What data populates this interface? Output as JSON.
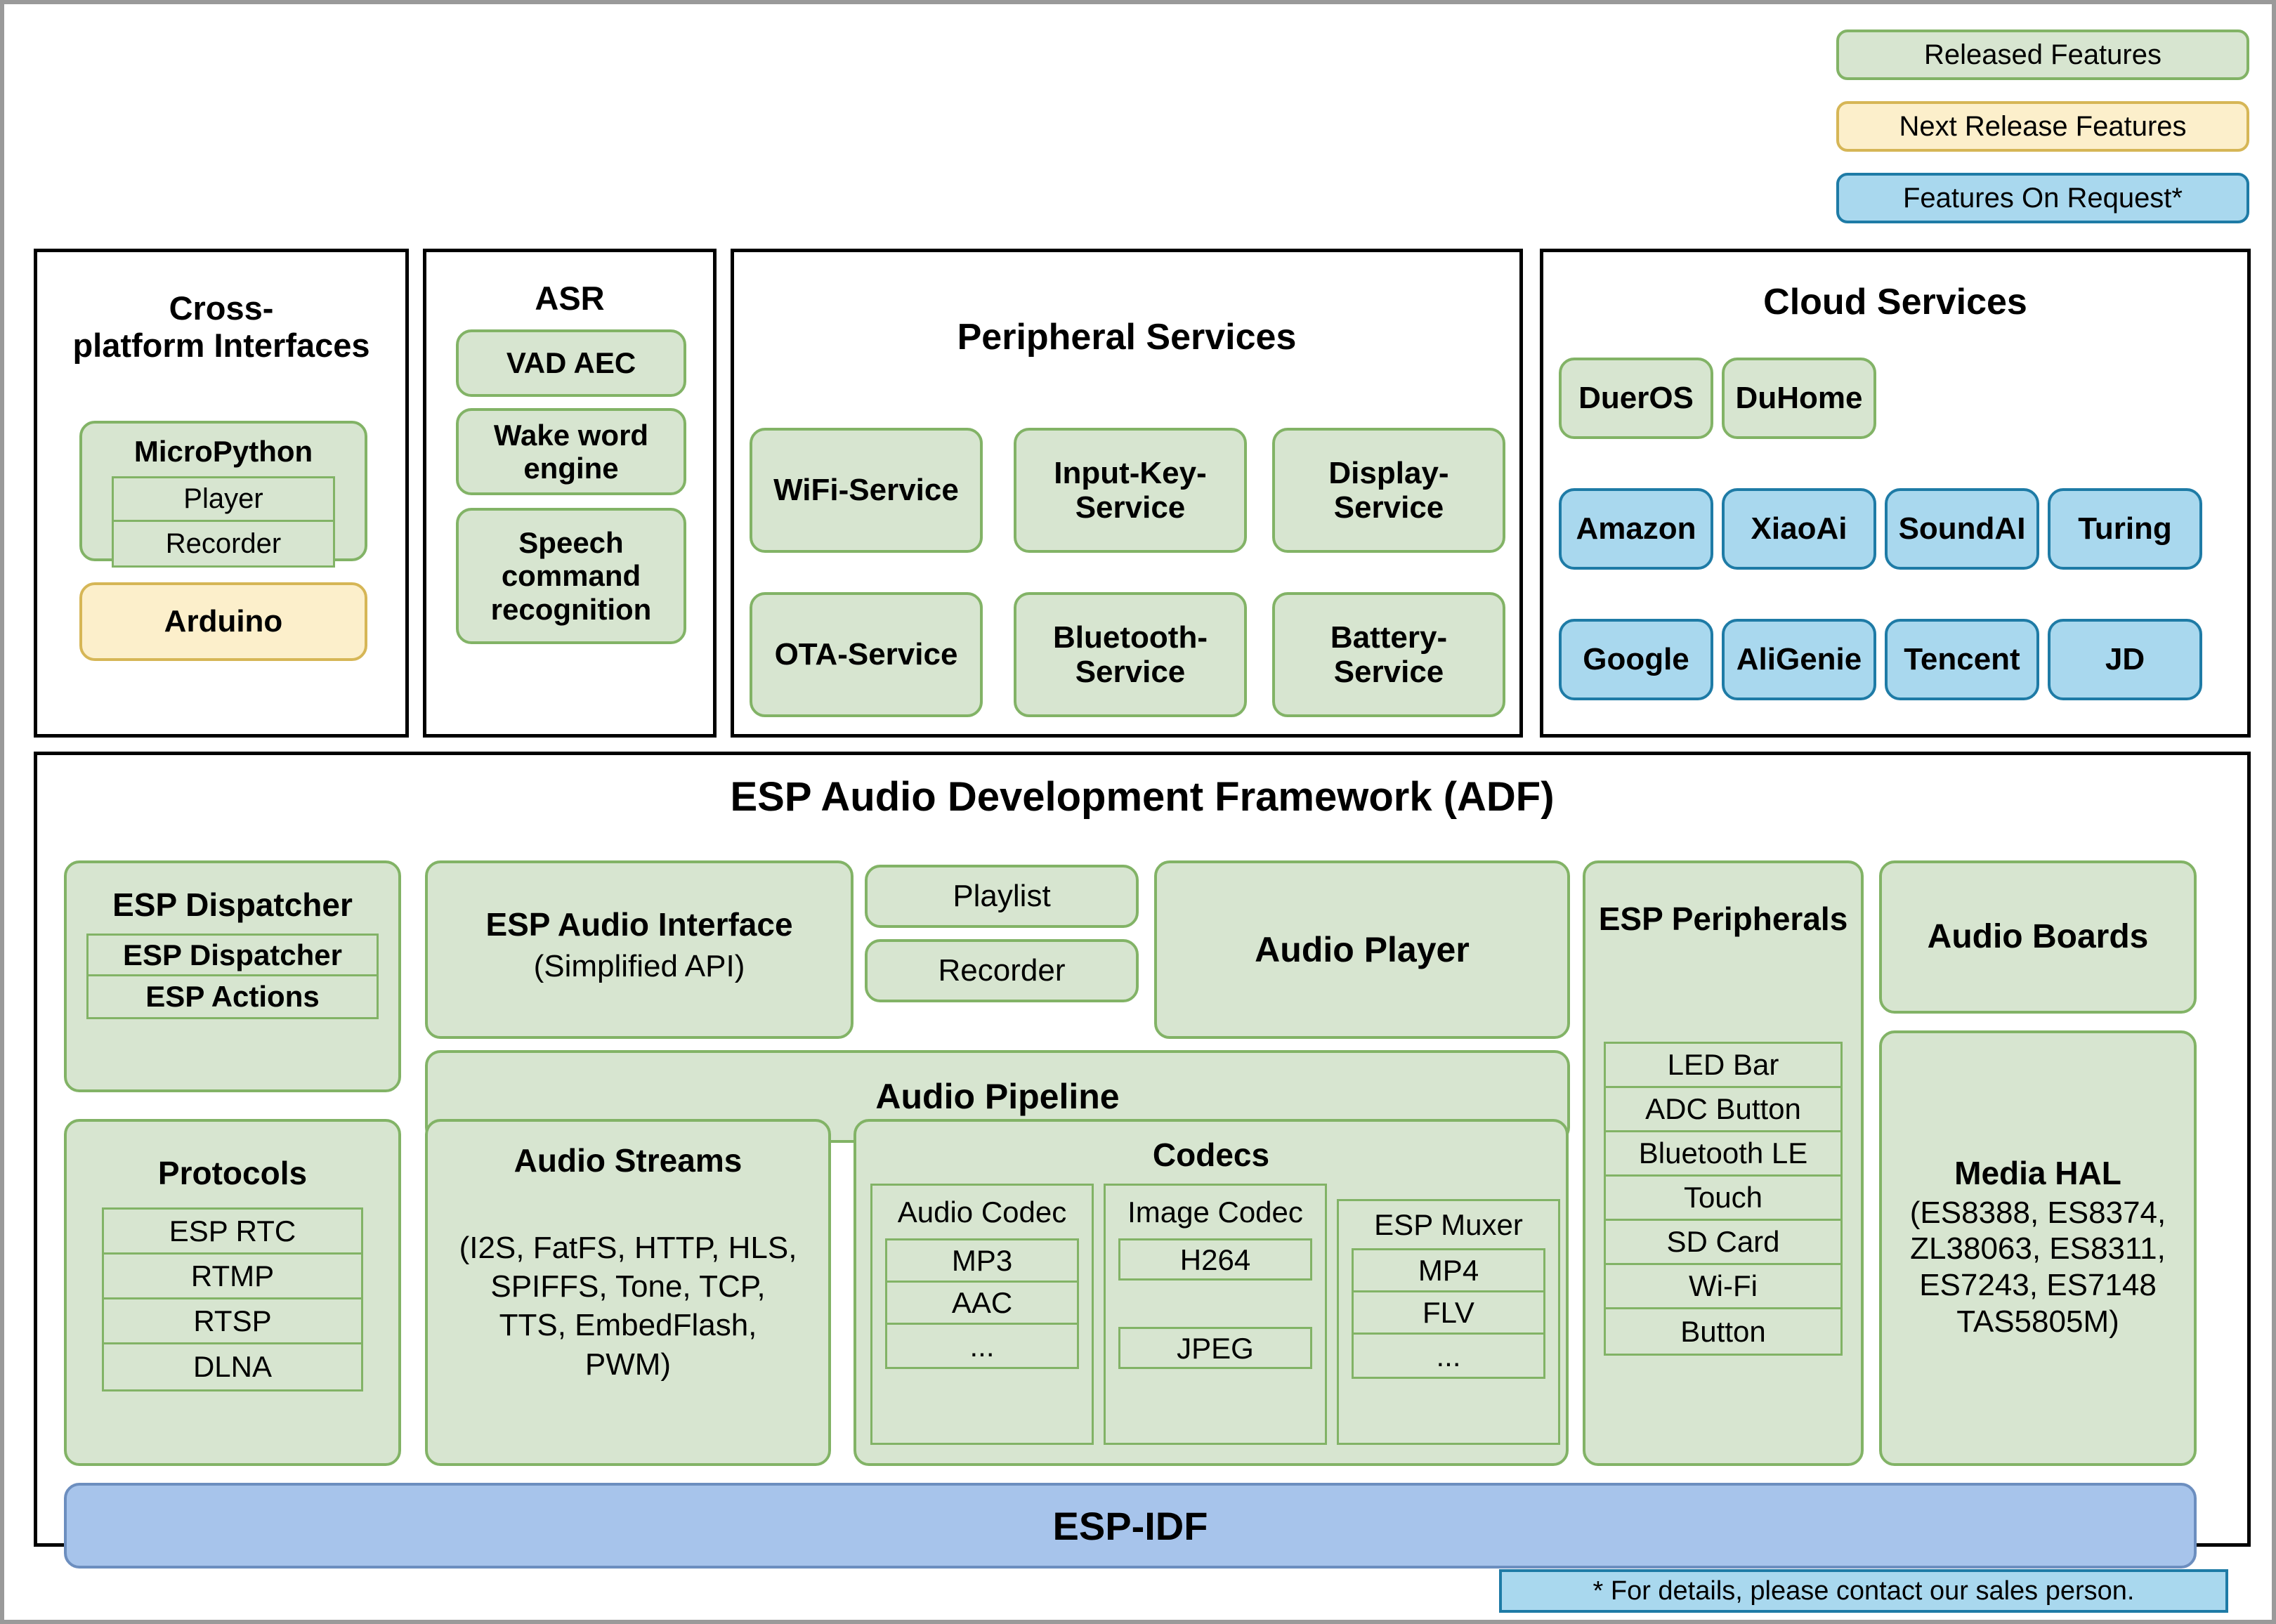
{
  "legend": {
    "items": [
      {
        "label": "Released Features",
        "color": "#d7e5d0"
      },
      {
        "label": "Next Release Features",
        "color": "#fcefcb"
      },
      {
        "label": "Features On Request*",
        "color": "#a9d8ee"
      }
    ]
  },
  "cross_platform": {
    "title": "Cross-\nplatform Interfaces",
    "title_line1": "Cross-",
    "title_line2": "platform Interfaces",
    "micropython": {
      "label": "MicroPython",
      "items": [
        "Player",
        "Recorder"
      ]
    },
    "arduino": "Arduino"
  },
  "asr": {
    "title": "ASR",
    "items": [
      "VAD AEC",
      "Wake word engine",
      "Speech command recognition"
    ]
  },
  "peripheral_services": {
    "title": "Peripheral Services",
    "items": [
      "WiFi-Service",
      "Input-Key-Service",
      "Display-Service",
      "OTA-Service",
      "Bluetooth-Service",
      "Battery-Service"
    ]
  },
  "cloud_services": {
    "title": "Cloud Services",
    "released": [
      "DuerOS",
      "DuHome"
    ],
    "on_request_row1": [
      "Amazon",
      "XiaoAi",
      "SoundAI",
      "Turing"
    ],
    "on_request_row2": [
      "Google",
      "AliGenie",
      "Tencent",
      "JD"
    ]
  },
  "adf": {
    "title": "ESP Audio Development Framework  (ADF)",
    "esp_dispatcher": {
      "label": "ESP Dispatcher",
      "items": [
        "ESP Dispatcher",
        "ESP Actions"
      ]
    },
    "esp_audio_interface": {
      "line1": "ESP Audio Interface",
      "line2": "(Simplified API)"
    },
    "playlist": "Playlist",
    "recorder": "Recorder",
    "audio_player": "Audio Player",
    "audio_pipeline": "Audio Pipeline",
    "esp_peripherals": {
      "label": "ESP Peripherals",
      "items": [
        "LED Bar",
        "ADC Button",
        "Bluetooth LE",
        "Touch",
        "SD Card",
        "Wi-Fi",
        "Button"
      ]
    },
    "audio_boards": "Audio Boards",
    "media_hal": {
      "title": "Media HAL",
      "detail_lines": [
        "(ES8388, ES8374,",
        "ZL38063, ES8311,",
        "ES7243, ES7148",
        "TAS5805M)"
      ]
    },
    "protocols": {
      "label": "Protocols",
      "items": [
        "ESP RTC",
        "RTMP",
        "RTSP",
        "DLNA"
      ]
    },
    "audio_streams": {
      "label": "Audio Streams",
      "detail_lines": [
        "(I2S, FatFS, HTTP, HLS,",
        "SPIFFS, Tone, TCP,",
        "TTS, EmbedFlash,",
        "PWM)"
      ]
    },
    "codecs": {
      "label": "Codecs",
      "audio_codec": {
        "label": "Audio Codec",
        "items": [
          "MP3",
          "AAC",
          "..."
        ]
      },
      "image_codec": {
        "label": "Image Codec",
        "items": [
          "H264",
          "JPEG"
        ]
      },
      "esp_muxer": {
        "label": "ESP Muxer",
        "items": [
          "MP4",
          "FLV",
          "..."
        ]
      }
    },
    "esp_idf": "ESP-IDF"
  },
  "footnote": "* For details, please contact our sales person.",
  "colors": {
    "released_fill": "#d7e5d0",
    "released_border": "#82b366",
    "next_release_fill": "#fcefcb",
    "next_release_border": "#d6b656",
    "on_request_fill": "#a9d8ee",
    "on_request_border": "#1e7ba6",
    "idf_fill": "#a7c4eb",
    "idf_border": "#6c8ebf"
  }
}
